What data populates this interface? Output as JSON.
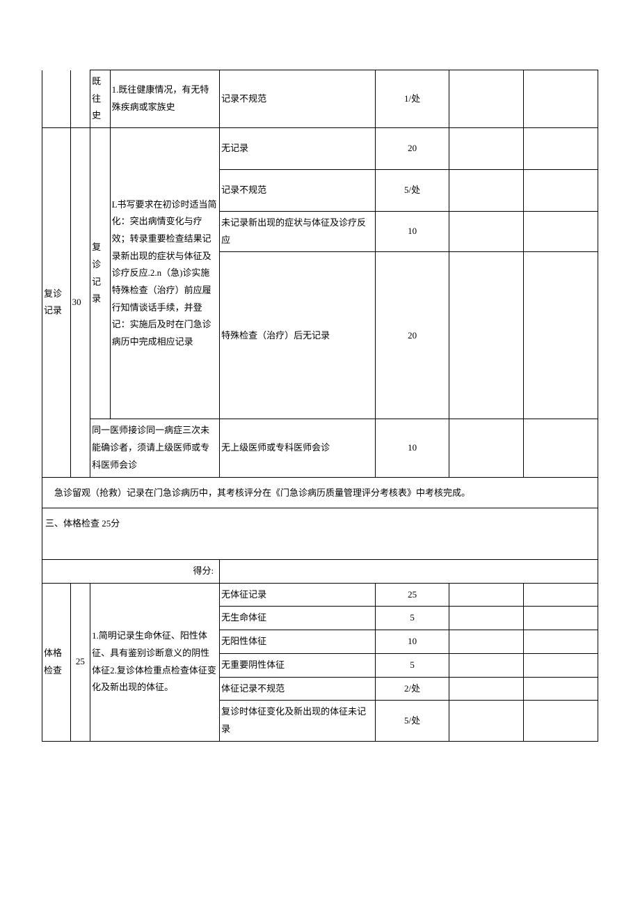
{
  "row1": {
    "c3": "既往史",
    "c4": "1.既往健康情况，有无特殊疾病或家族史",
    "c5": "记录不规范",
    "c6": "1/处"
  },
  "fuzhen": {
    "c1": "复诊记录",
    "c2": "30",
    "c3": "复诊记录",
    "c4": "L书写要求在初诊时适当简化：突出病情变化与疗效；转录重要检查结果记录新出现的症状与体征及诊疗反应.2.n（急)诊实施特殊检查（治疗）前应履行知情谈话手续，并登记：实施后及时在门急诊病历中完成相应记录",
    "r1c5": "无记录",
    "r1c6": "20",
    "r2c5": "记录不规范",
    "r2c6": "5/处",
    "r3c5": "未记录新出现的症状与体征及诊疗反应",
    "r3c6": "10",
    "r4c5": "特殊检查（治疗）后无记录",
    "r4c6": "20",
    "sub2c4": "同一医师接诊同一病症三次未能确诊者，须请上级医师或专科医师会诊",
    "sub2c5": "无上级医师或专科医师会诊",
    "sub2c6": "10"
  },
  "note": "急诊留观（抢救）记录在门急诊病历中，其考核评分在《门急诊病历质量管理评分考核表》中考核完成。",
  "section3": {
    "title": "三、体格检查 25分",
    "score_label": "得分:"
  },
  "tige": {
    "c1": "体格检查",
    "c2": "25",
    "c4": "1.简明记录生命休征、阳性体征、具有鉴别诊断意义的阴性体征2.复诊体检重点检查体征变化及新出现的体征。",
    "r1c5": "无体征记录",
    "r1c6": "25",
    "r2c5": "无生命体征",
    "r2c6": "5",
    "r3c5": "无阳性体征",
    "r3c6": "10",
    "r4c5": "无重要阴性体征",
    "r4c6": "5",
    "r5c5": "体征记录不规范",
    "r5c6": "2/处",
    "r6c5": "复诊时体征变化及新出现的体征未记录",
    "r6c6": "5/处"
  }
}
